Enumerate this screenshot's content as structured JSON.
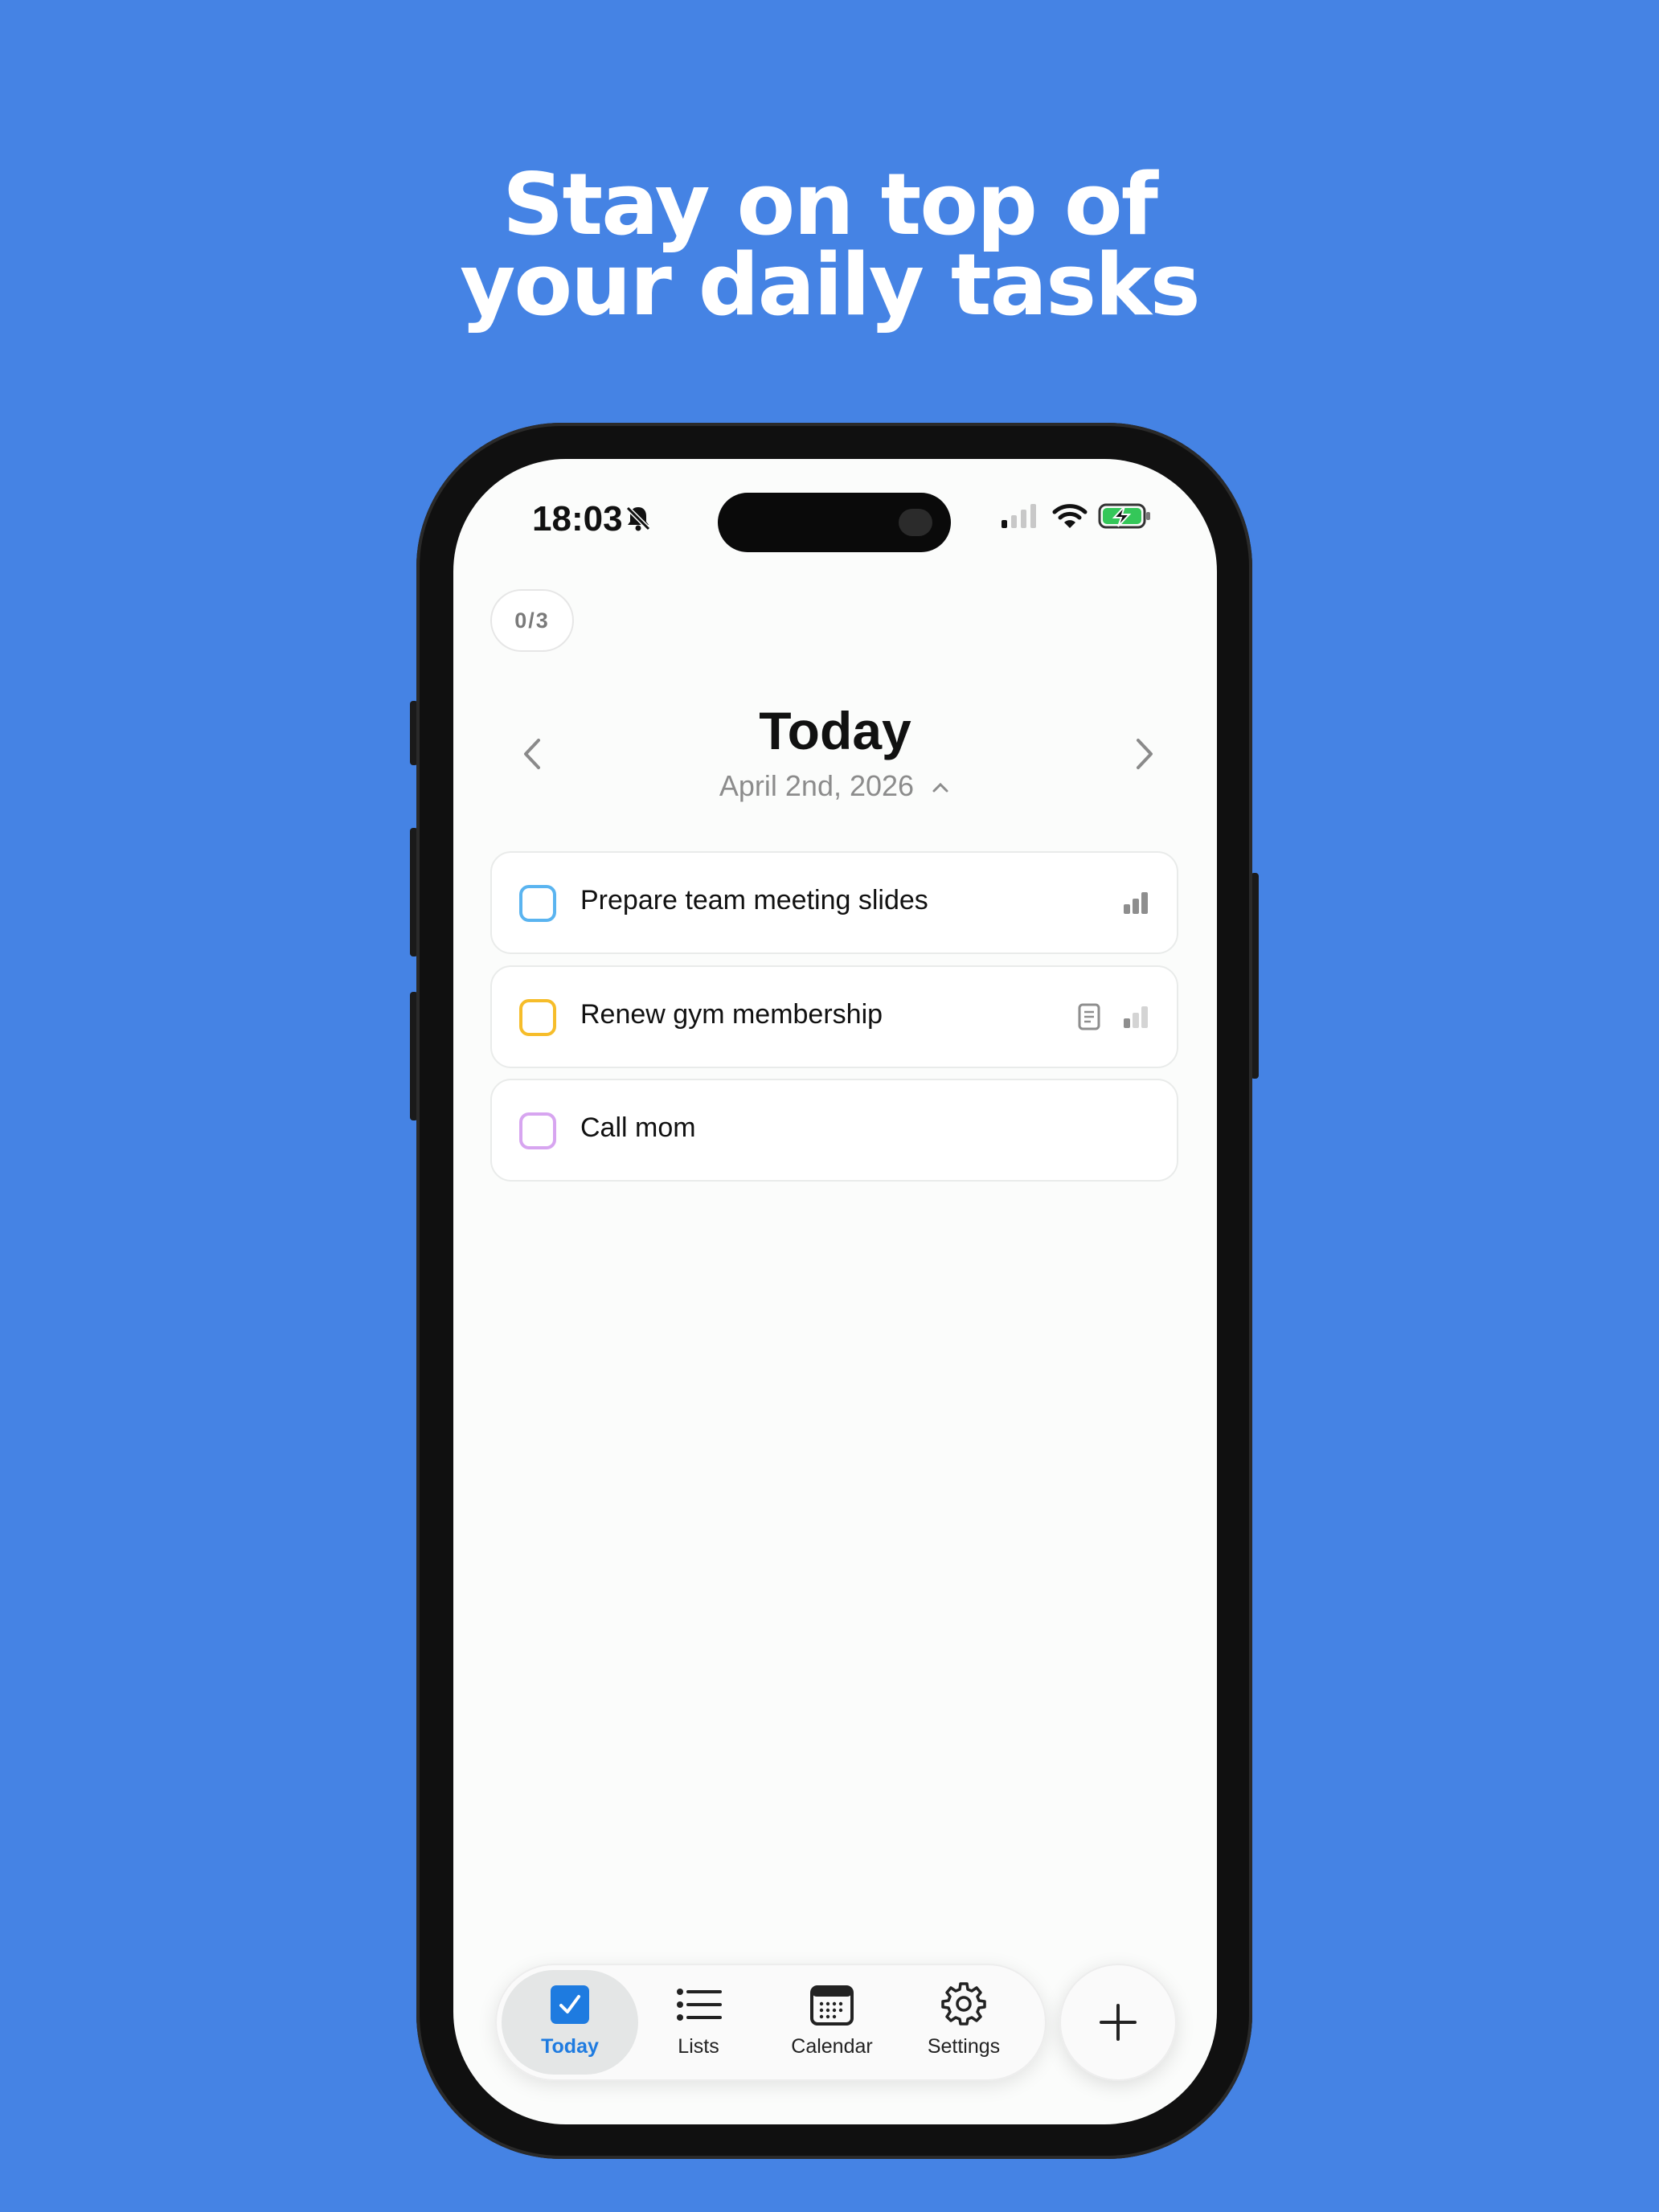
{
  "headline": {
    "line1": "Stay on top of",
    "line2": "your daily tasks"
  },
  "status_bar": {
    "time": "18:03"
  },
  "progress": {
    "counter": "0/3"
  },
  "header": {
    "title": "Today",
    "date": "April 2nd, 2026"
  },
  "tasks": [
    {
      "label": "Prepare team meeting slides",
      "color": "#5ab4f0",
      "has_note": false,
      "priority": "high"
    },
    {
      "label": "Renew gym membership",
      "color": "#f6bd2a",
      "has_note": true,
      "priority": "low"
    },
    {
      "label": "Call mom",
      "color": "#d7a5f0",
      "has_note": false,
      "priority": "none"
    }
  ],
  "tabbar": {
    "items": [
      {
        "label": "Today",
        "icon": "checkbox-icon",
        "active": true
      },
      {
        "label": "Lists",
        "icon": "list-icon",
        "active": false
      },
      {
        "label": "Calendar",
        "icon": "calendar-icon",
        "active": false
      },
      {
        "label": "Settings",
        "icon": "gear-icon",
        "active": false
      }
    ],
    "accent": "#1e7be0"
  },
  "fab": {
    "icon": "plus-icon"
  }
}
